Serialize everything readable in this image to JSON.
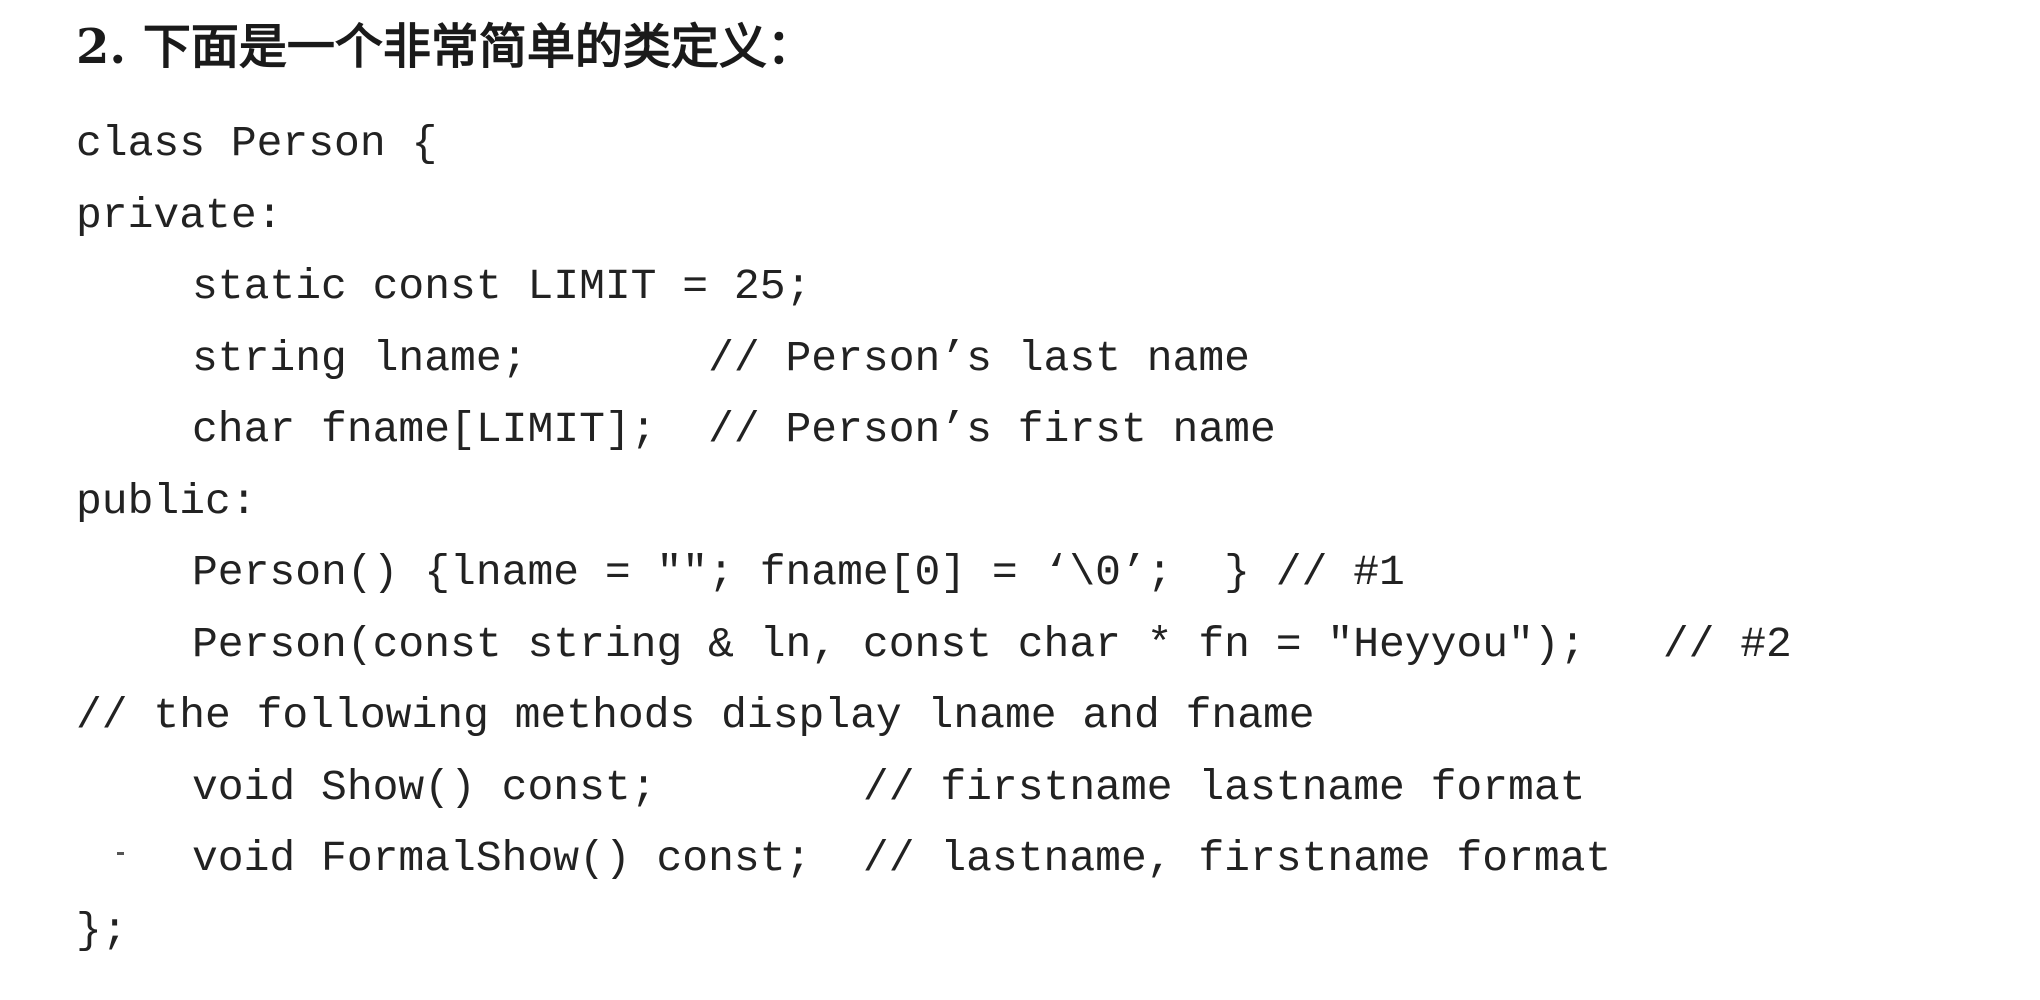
{
  "heading": "2. 下面是一个非常简单的类定义：",
  "code": {
    "line_01": "class Person {",
    "line_02": "private:",
    "line_03": "static const LIMIT = 25;",
    "line_04": "string lname;       // Person’s last name",
    "line_05": "char fname[LIMIT];  // Person’s first name",
    "line_06": "public:",
    "line_07": "Person() {lname = \"\"; fname[0] = ‘\\0’;  } // #1",
    "line_08": "Person(const string & ln, const char * fn = \"Heyyou\");   // #2",
    "line_09": "// the following methods display lname and fname",
    "line_10": "void Show() const;        // firstname lastname format",
    "line_11": "void FormalShow() const;  // lastname, firstname format",
    "line_12": "};"
  }
}
